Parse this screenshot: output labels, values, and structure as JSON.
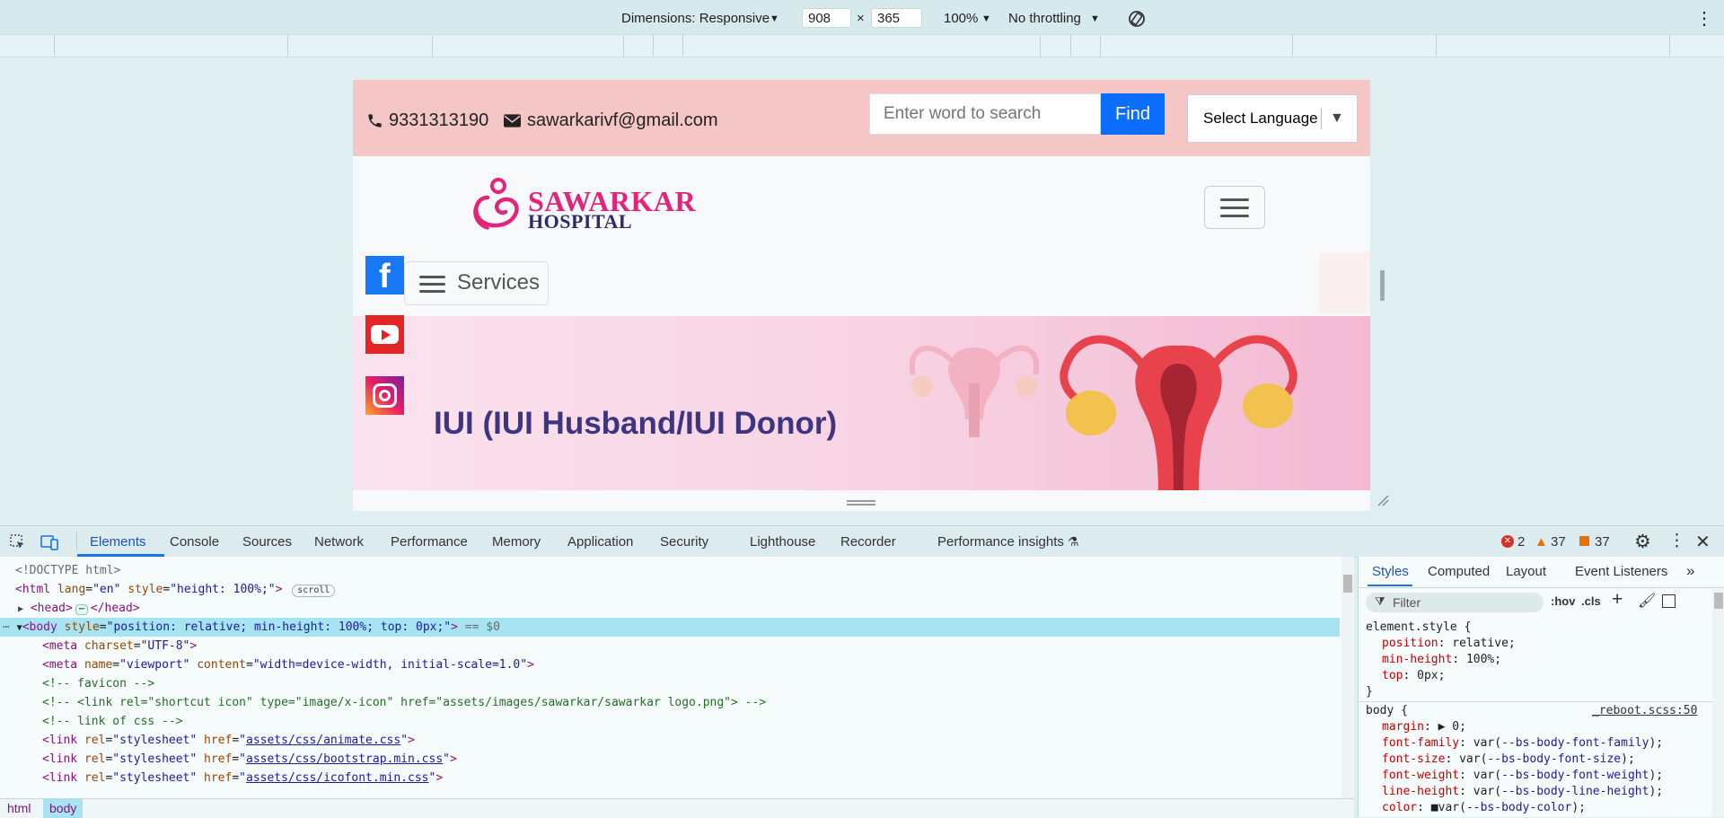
{
  "device_toolbar": {
    "dimensions_label": "Dimensions: Responsive",
    "width": "908",
    "times": "×",
    "height": "365",
    "zoom": "100%",
    "throttling": "No throttling"
  },
  "site": {
    "phone": "9331313190",
    "email": "sawarkarivf@gmail.com",
    "search_placeholder": "Enter word to search",
    "find_label": "Find",
    "language_label": "Select Language",
    "language_arrow": "▼",
    "logo_line1": "SAWARKAR",
    "logo_line2": "HOSPITAL",
    "services_label": "Services",
    "banner_title": "IUI (IUI Husband/IUI Donor)",
    "colors": {
      "brand_pink": "#e2247a",
      "brand_navy": "#2e2a6e",
      "topbar": "#f5c6c6",
      "find_button": "#0d6efd",
      "facebook": "#1877f2",
      "youtube": "#e32526"
    }
  },
  "devtools": {
    "tabs": [
      "Elements",
      "Console",
      "Sources",
      "Network",
      "Performance",
      "Memory",
      "Application",
      "Security",
      "Lighthouse",
      "Recorder",
      "Performance insights"
    ],
    "errors": "2",
    "warnings": "37",
    "issues": "37",
    "elements_lines": [
      "<!DOCTYPE html>",
      "<html lang=\"en\" style=\"height: 100%;\">",
      "scroll",
      "<head>",
      "</head>",
      "<body style=\"position: relative; min-height: 100%; top: 0px;\">",
      "== $0",
      "<meta charset=\"UTF-8\">",
      "<meta name=\"viewport\" content=\"width=device-width, initial-scale=1.0\">",
      "<!-- favicon -->",
      "<!-- <link rel=\"shortcut icon\" type=\"image/x-icon\" href=\"assets/images/sawarkar/sawarkar logo.png\"> -->",
      "<!-- link of css -->",
      "assets/css/animate.css",
      "assets/css/bootstrap.min.css",
      "assets/css/icofont.min.css"
    ],
    "styles_tabs": [
      "Styles",
      "Computed",
      "Layout",
      "Event Listeners"
    ],
    "filter_placeholder": "Filter",
    "hov": ":hov",
    "cls": ".cls",
    "styles_lines": [
      "element.style {",
      "position: relative;",
      "min-height: 100%;",
      "top: 0px;",
      "}",
      "body {",
      "_reboot.scss:50",
      "margin: ▶ 0;",
      "font-family: var(--bs-body-font-family);",
      "font-size: var(--bs-body-font-size);",
      "font-weight: var(--bs-body-font-weight);",
      "line-height: var(--bs-body-line-height);",
      "color: ■var(--bs-body-color);"
    ],
    "breadcrumbs": [
      "html",
      "body"
    ]
  }
}
